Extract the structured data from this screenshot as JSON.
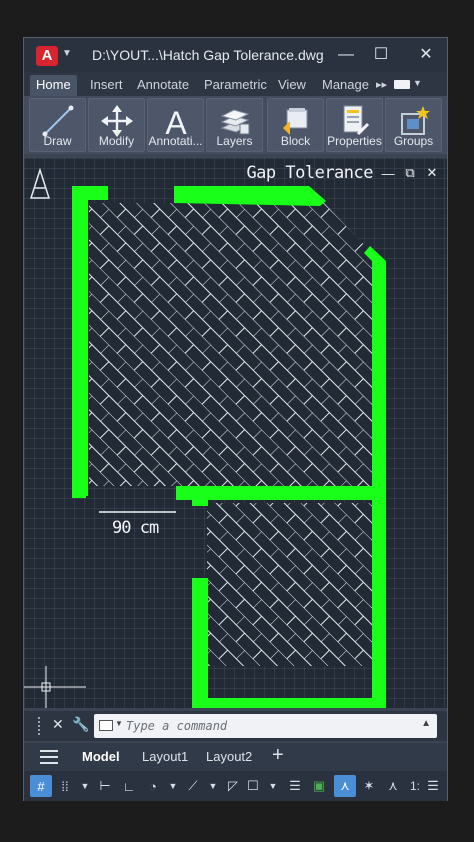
{
  "window": {
    "title": "D:\\YOUT...\\Hatch Gap Tolerance.dwg",
    "app_logo": "A",
    "minimize": "—",
    "maximize": "☐",
    "close": "✕"
  },
  "ribbon": {
    "tabs": [
      "Home",
      "Insert",
      "Annotate",
      "Parametric",
      "View",
      "Manage"
    ],
    "more": "▸▸",
    "buttons": [
      {
        "label": "Draw",
        "icon": "line-draw-icon"
      },
      {
        "label": "Modify",
        "icon": "move-arrows-icon"
      },
      {
        "label": "Annotati...",
        "icon": "text-a-icon"
      },
      {
        "label": "Layers",
        "icon": "layers-stack-icon"
      },
      {
        "label": "Block",
        "icon": "block-insert-icon"
      },
      {
        "label": "Properties",
        "icon": "properties-icon"
      },
      {
        "label": "Groups",
        "icon": "group-icon"
      }
    ]
  },
  "canvas": {
    "viewport_title": "Gap Tolerance",
    "vp_minimize": "—",
    "vp_restore": "⧉",
    "vp_close": "✕",
    "dimension_label": "90 cm",
    "wall_color": "#1aff1a",
    "hatch_color": "#e6e9ee"
  },
  "command": {
    "placeholder": "Type a command"
  },
  "layouts": {
    "tabs": [
      "Model",
      "Layout1",
      "Layout2"
    ],
    "active": "Model",
    "add": "+"
  },
  "status": {
    "scale_label": "1:"
  }
}
